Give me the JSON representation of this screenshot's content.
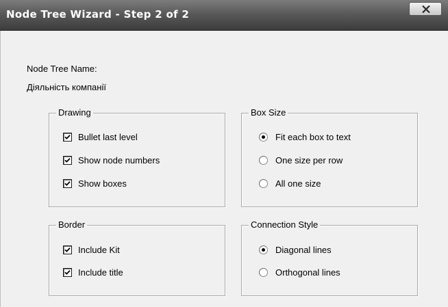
{
  "window": {
    "title": "Node Tree Wizard - Step 2 of 2",
    "close_glyph": "X"
  },
  "form": {
    "name_label": "Node Tree Name:",
    "name_value": "Діяльність компанії"
  },
  "groups": {
    "drawing": {
      "legend": "Drawing",
      "options": [
        {
          "label": "Bullet last level",
          "checked": true
        },
        {
          "label": "Show node numbers",
          "checked": true
        },
        {
          "label": "Show boxes",
          "checked": true
        }
      ]
    },
    "box_size": {
      "legend": "Box Size",
      "options": [
        {
          "label": "Fit each box to text",
          "selected": true
        },
        {
          "label": "One size per row",
          "selected": false
        },
        {
          "label": "All one size",
          "selected": false
        }
      ]
    },
    "border": {
      "legend": "Border",
      "options": [
        {
          "label": "Include Kit",
          "checked": true
        },
        {
          "label": "Include title",
          "checked": true
        }
      ]
    },
    "connection_style": {
      "legend": "Connection Style",
      "options": [
        {
          "label": "Diagonal lines",
          "selected": true
        },
        {
          "label": "Orthogonal lines",
          "selected": false
        }
      ]
    }
  }
}
